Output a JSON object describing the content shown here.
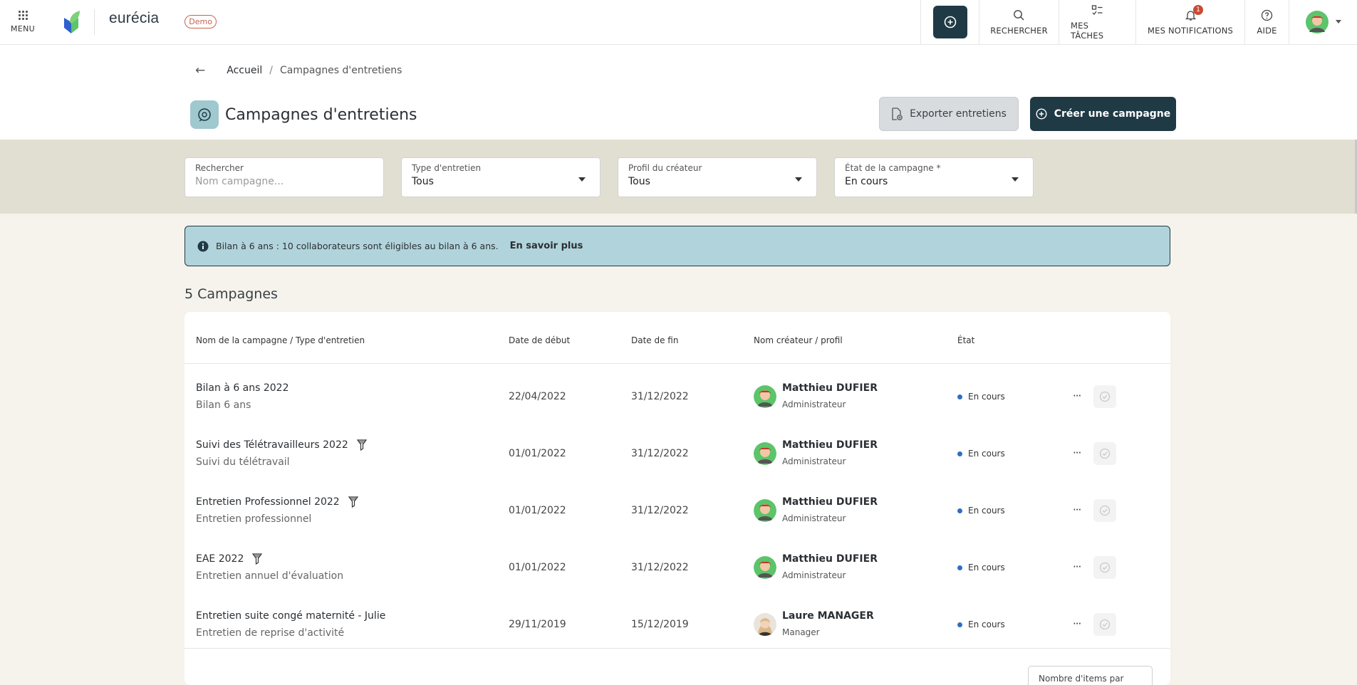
{
  "topbar": {
    "menu_label": "MENU",
    "brand": "eurécia",
    "demo_badge": "Demo",
    "items": [
      {
        "label": "RECHERCHER",
        "icon": "search-icon"
      },
      {
        "label": "MES TÂCHES",
        "icon": "tasks-icon"
      },
      {
        "label": "MES NOTIFICATIONS",
        "icon": "bell-icon",
        "badge": "1"
      },
      {
        "label": "AIDE",
        "icon": "help-icon"
      }
    ]
  },
  "breadcrumb": {
    "back": "←",
    "home": "Accueil",
    "separator": "/",
    "current": "Campagnes d'entretiens"
  },
  "header": {
    "title": "Campagnes d'entretiens",
    "export_label": "Exporter entretiens",
    "create_label": "Créer une campagne"
  },
  "filters": {
    "search": {
      "label": "Rechercher",
      "placeholder": "Nom campagne..."
    },
    "type": {
      "label": "Type d'entretien",
      "value": "Tous"
    },
    "profile": {
      "label": "Profil du créateur",
      "value": "Tous"
    },
    "state": {
      "label": "État de la campagne *",
      "value": "En cours"
    }
  },
  "info": {
    "text": "Bilan à 6 ans : 10 collaborateurs sont éligibles au bilan à 6 ans.",
    "link": "En savoir plus"
  },
  "campaigns_count": "5 Campagnes",
  "table": {
    "headers": [
      "Nom de la campagne / Type d'entretien",
      "Date de début",
      "Date de fin",
      "Nom créateur / profil",
      "État"
    ],
    "rows": [
      {
        "name": "Bilan à 6 ans 2022",
        "type": "Bilan 6 ans",
        "start": "22/04/2022",
        "end": "31/12/2022",
        "creator": "Matthieu DUFIER",
        "profile": "Administrateur",
        "state": "En cours",
        "menu": "···",
        "filter_icon": false,
        "avatar": "man"
      },
      {
        "name": "Suivi des Télétravailleurs 2022",
        "type": "Suivi du télétravail",
        "start": "01/01/2022",
        "end": "31/12/2022",
        "creator": "Matthieu DUFIER",
        "profile": "Administrateur",
        "state": "En cours",
        "menu": "···",
        "filter_icon": true,
        "avatar": "man"
      },
      {
        "name": "Entretien Professionnel 2022",
        "type": "Entretien professionnel",
        "start": "01/01/2022",
        "end": "31/12/2022",
        "creator": "Matthieu DUFIER",
        "profile": "Administrateur",
        "state": "En cours",
        "menu": "···",
        "filter_icon": true,
        "avatar": "man"
      },
      {
        "name": "EAE 2022",
        "type": "Entretien annuel d'évaluation",
        "start": "01/01/2022",
        "end": "31/12/2022",
        "creator": "Matthieu DUFIER",
        "profile": "Administrateur",
        "state": "En cours",
        "menu": "···",
        "filter_icon": true,
        "avatar": "man"
      },
      {
        "name": "Entretien suite congé maternité - Julie",
        "type": "Entretien de reprise d'activité",
        "start": "29/11/2019",
        "end": "15/12/2019",
        "creator": "Laure MANAGER",
        "profile": "Manager",
        "state": "En cours",
        "menu": "···",
        "filter_icon": false,
        "avatar": "woman"
      }
    ]
  },
  "pagination": {
    "per_page_label": "Nombre d'items par page"
  },
  "colors": {
    "primary": "#1f3a45",
    "info_bg": "#b1d4dc",
    "filter_bg": "#e1dfd2",
    "page_bg": "#f5f3ec",
    "notif": "#c94b35",
    "state_dot": "#2f6ec2"
  }
}
